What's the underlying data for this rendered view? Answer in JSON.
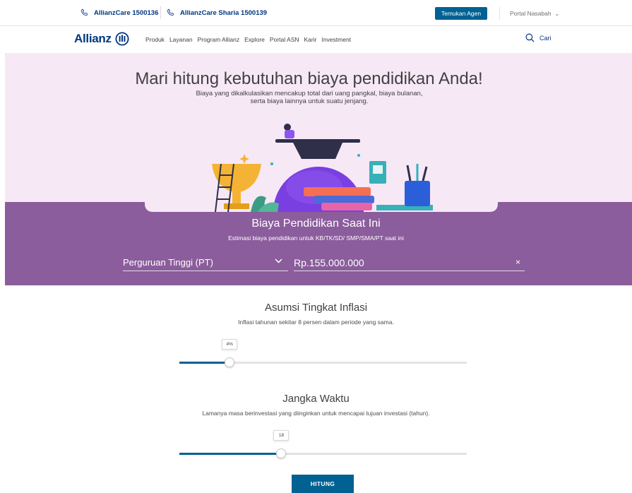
{
  "topbar": {
    "phone1": "AllianzCare 1500136",
    "phone2": "AllianzCare Sharia 1500139",
    "agent_button": "Temukan Agen",
    "portal": "Portal Nasabah"
  },
  "nav": {
    "logo": "Allianz",
    "items": [
      "Produk",
      "Layanan",
      "Program Allianz",
      "Explore",
      "Portal ASN",
      "Karir",
      "Investment"
    ],
    "search_label": "Cari"
  },
  "hero": {
    "title": "Mari hitung kebutuhan biaya pendidikan Anda!",
    "subtitle_line1": "Biaya yang dikalkulasikan mencakup total dari uang pangkal, biaya bulanan,",
    "subtitle_line2": "serta biaya lainnya untuk suatu jenjang."
  },
  "current_cost": {
    "title": "Biaya Pendidikan Saat Ini",
    "subtitle": "Estimasi biaya pendidikan untuk KB/TK/SD/ SMP/SMA/PT saat ini",
    "level_selected": "Perguruan Tinggi (PT)",
    "amount_value": "Rp.155.000.000",
    "clear_symbol": "×"
  },
  "inflation": {
    "title": "Asumsi Tingkat Inflasi",
    "subtitle": "Inflasi tahunan sekitar 8 persen dalam periode yang sama.",
    "value_label": "4%",
    "fraction": 0.175
  },
  "duration": {
    "title": "Jangka Waktu",
    "subtitle": "Lamanya masa berinvestasi yang diinginkan untuk mencapai tujuan investasi (tahun).",
    "value_label": "18",
    "fraction": 0.355
  },
  "submit_label": "HITUNG",
  "colors": {
    "brand_blue": "#003781",
    "button_blue": "#006192",
    "hero_bg": "#f7e8f6",
    "band_purple": "#8b5d9c"
  }
}
